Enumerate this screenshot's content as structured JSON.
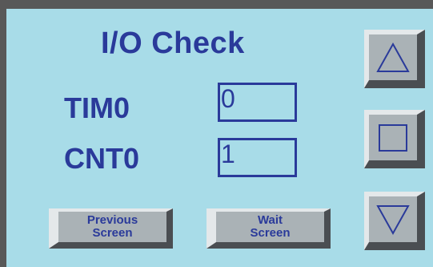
{
  "screen": {
    "title": "I/O Check"
  },
  "fields": [
    {
      "label": "TIM0",
      "value": "0"
    },
    {
      "label": "CNT0",
      "value": "1"
    }
  ],
  "buttons": {
    "previous_line1": "Previous",
    "previous_line2": "Screen",
    "wait_line1": "Wait",
    "wait_line2": "Screen"
  },
  "nav": {
    "up_icon": "triangle-up-icon",
    "home_icon": "square-icon",
    "down_icon": "triangle-down-icon"
  },
  "colors": {
    "background": "#a8dce8",
    "frame": "#585858",
    "text": "#2a3a9a",
    "button_face": "#aab2b6"
  }
}
